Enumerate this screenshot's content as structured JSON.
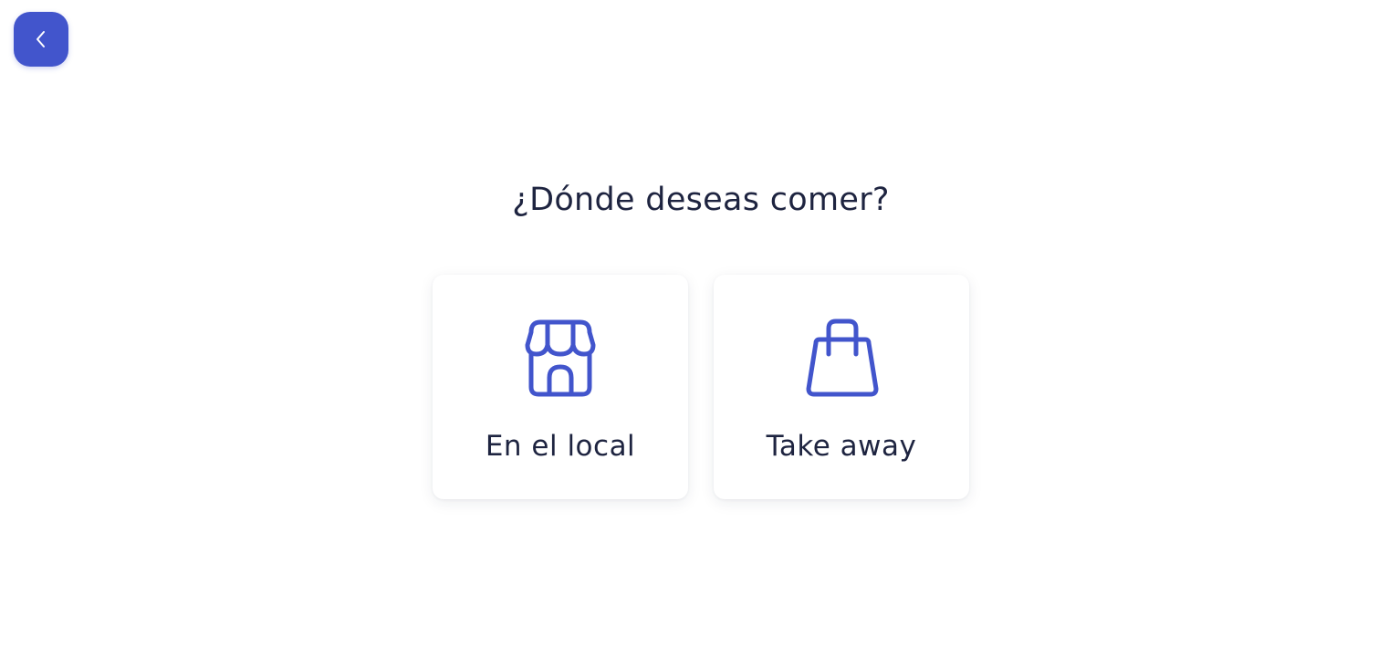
{
  "header": {
    "back_icon": "chevron-left-icon"
  },
  "main": {
    "title": "¿Dónde deseas comer?",
    "options": [
      {
        "label": "En el local",
        "icon": "storefront-icon"
      },
      {
        "label": "Take away",
        "icon": "shopping-bag-icon"
      }
    ]
  },
  "colors": {
    "accent": "#4255cc",
    "text": "#1e2440",
    "background": "#ffffff"
  }
}
